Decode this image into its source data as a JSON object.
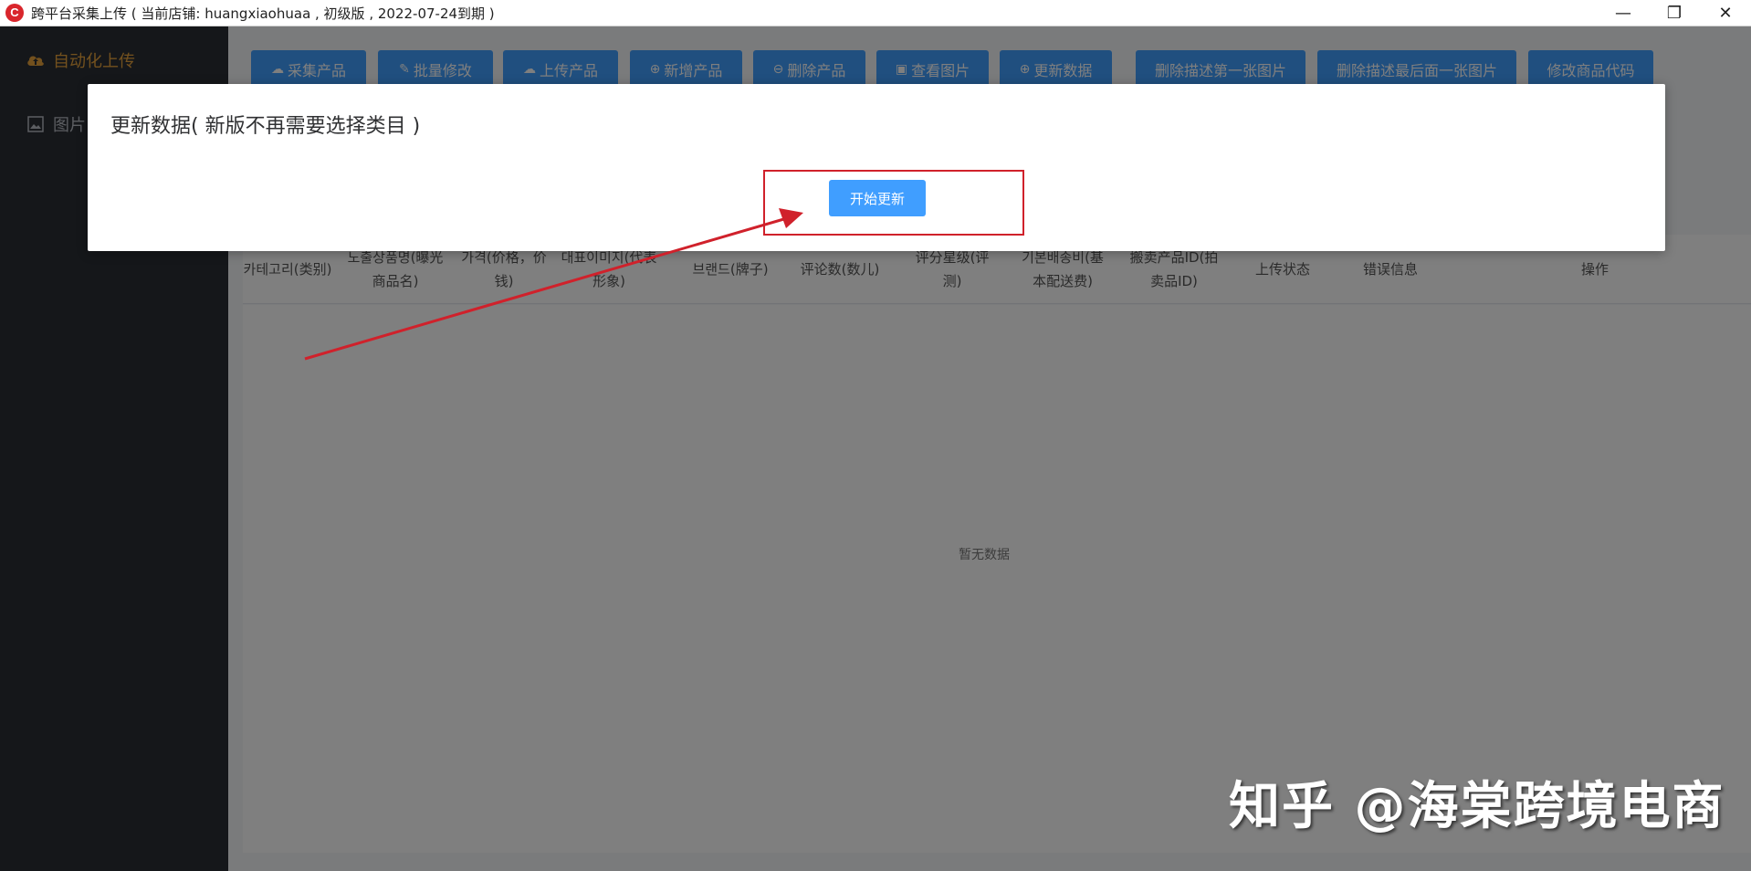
{
  "window": {
    "logo_letter": "C",
    "title": "跨平台采集上传 ( 当前店铺: huangxiaohuaa , 初级版 , 2022-07-24到期 )",
    "minimize": "—",
    "restore": "❐",
    "close": "✕"
  },
  "sidebar": {
    "items": [
      {
        "label": "自动化上传",
        "icon": "cloud-upload-icon",
        "active": true
      },
      {
        "label": "图片",
        "icon": "image-icon",
        "active": false
      }
    ]
  },
  "toolbar": {
    "buttons": [
      {
        "label": "采集产品",
        "icon": "cloud-upload-icon",
        "glyph": "☁"
      },
      {
        "label": "批量修改",
        "icon": "edit-icon",
        "glyph": "✎"
      },
      {
        "label": "上传产品",
        "icon": "cloud-upload-icon",
        "glyph": "☁"
      },
      {
        "label": "新增产品",
        "icon": "plus-circle-icon",
        "glyph": "⊕"
      },
      {
        "label": "删除产品",
        "icon": "minus-circle-icon",
        "glyph": "⊖"
      },
      {
        "label": "查看图片",
        "icon": "picture-icon",
        "glyph": "▣"
      },
      {
        "label": "更新数据",
        "icon": "plus-circle-icon",
        "glyph": "⊕"
      },
      {
        "label": "删除描述第一张图片",
        "icon": "",
        "glyph": ""
      },
      {
        "label": "删除描述最后面一张图片",
        "icon": "",
        "glyph": ""
      },
      {
        "label": "修改商品代码",
        "icon": "",
        "glyph": ""
      }
    ]
  },
  "table": {
    "columns": [
      "카테고리(类别)",
      "노출상품명(曝光商品名)",
      "가격(价格，价钱)",
      "대표이미지(代表形象)",
      "브랜드(牌子)",
      "评论数(数儿)",
      "评分星级(评测)",
      "기본배송비(基本配送费)",
      "搬卖产品ID(拍卖品ID)",
      "上传状态",
      "错误信息",
      "操作"
    ],
    "empty_text": "暂无数据"
  },
  "dialog": {
    "title": "更新数据( 新版不再需要选择类目 )",
    "start_button": "开始更新"
  },
  "annotation": {
    "color": "#d0212b"
  },
  "watermark": "知乎 @海棠跨境电商"
}
